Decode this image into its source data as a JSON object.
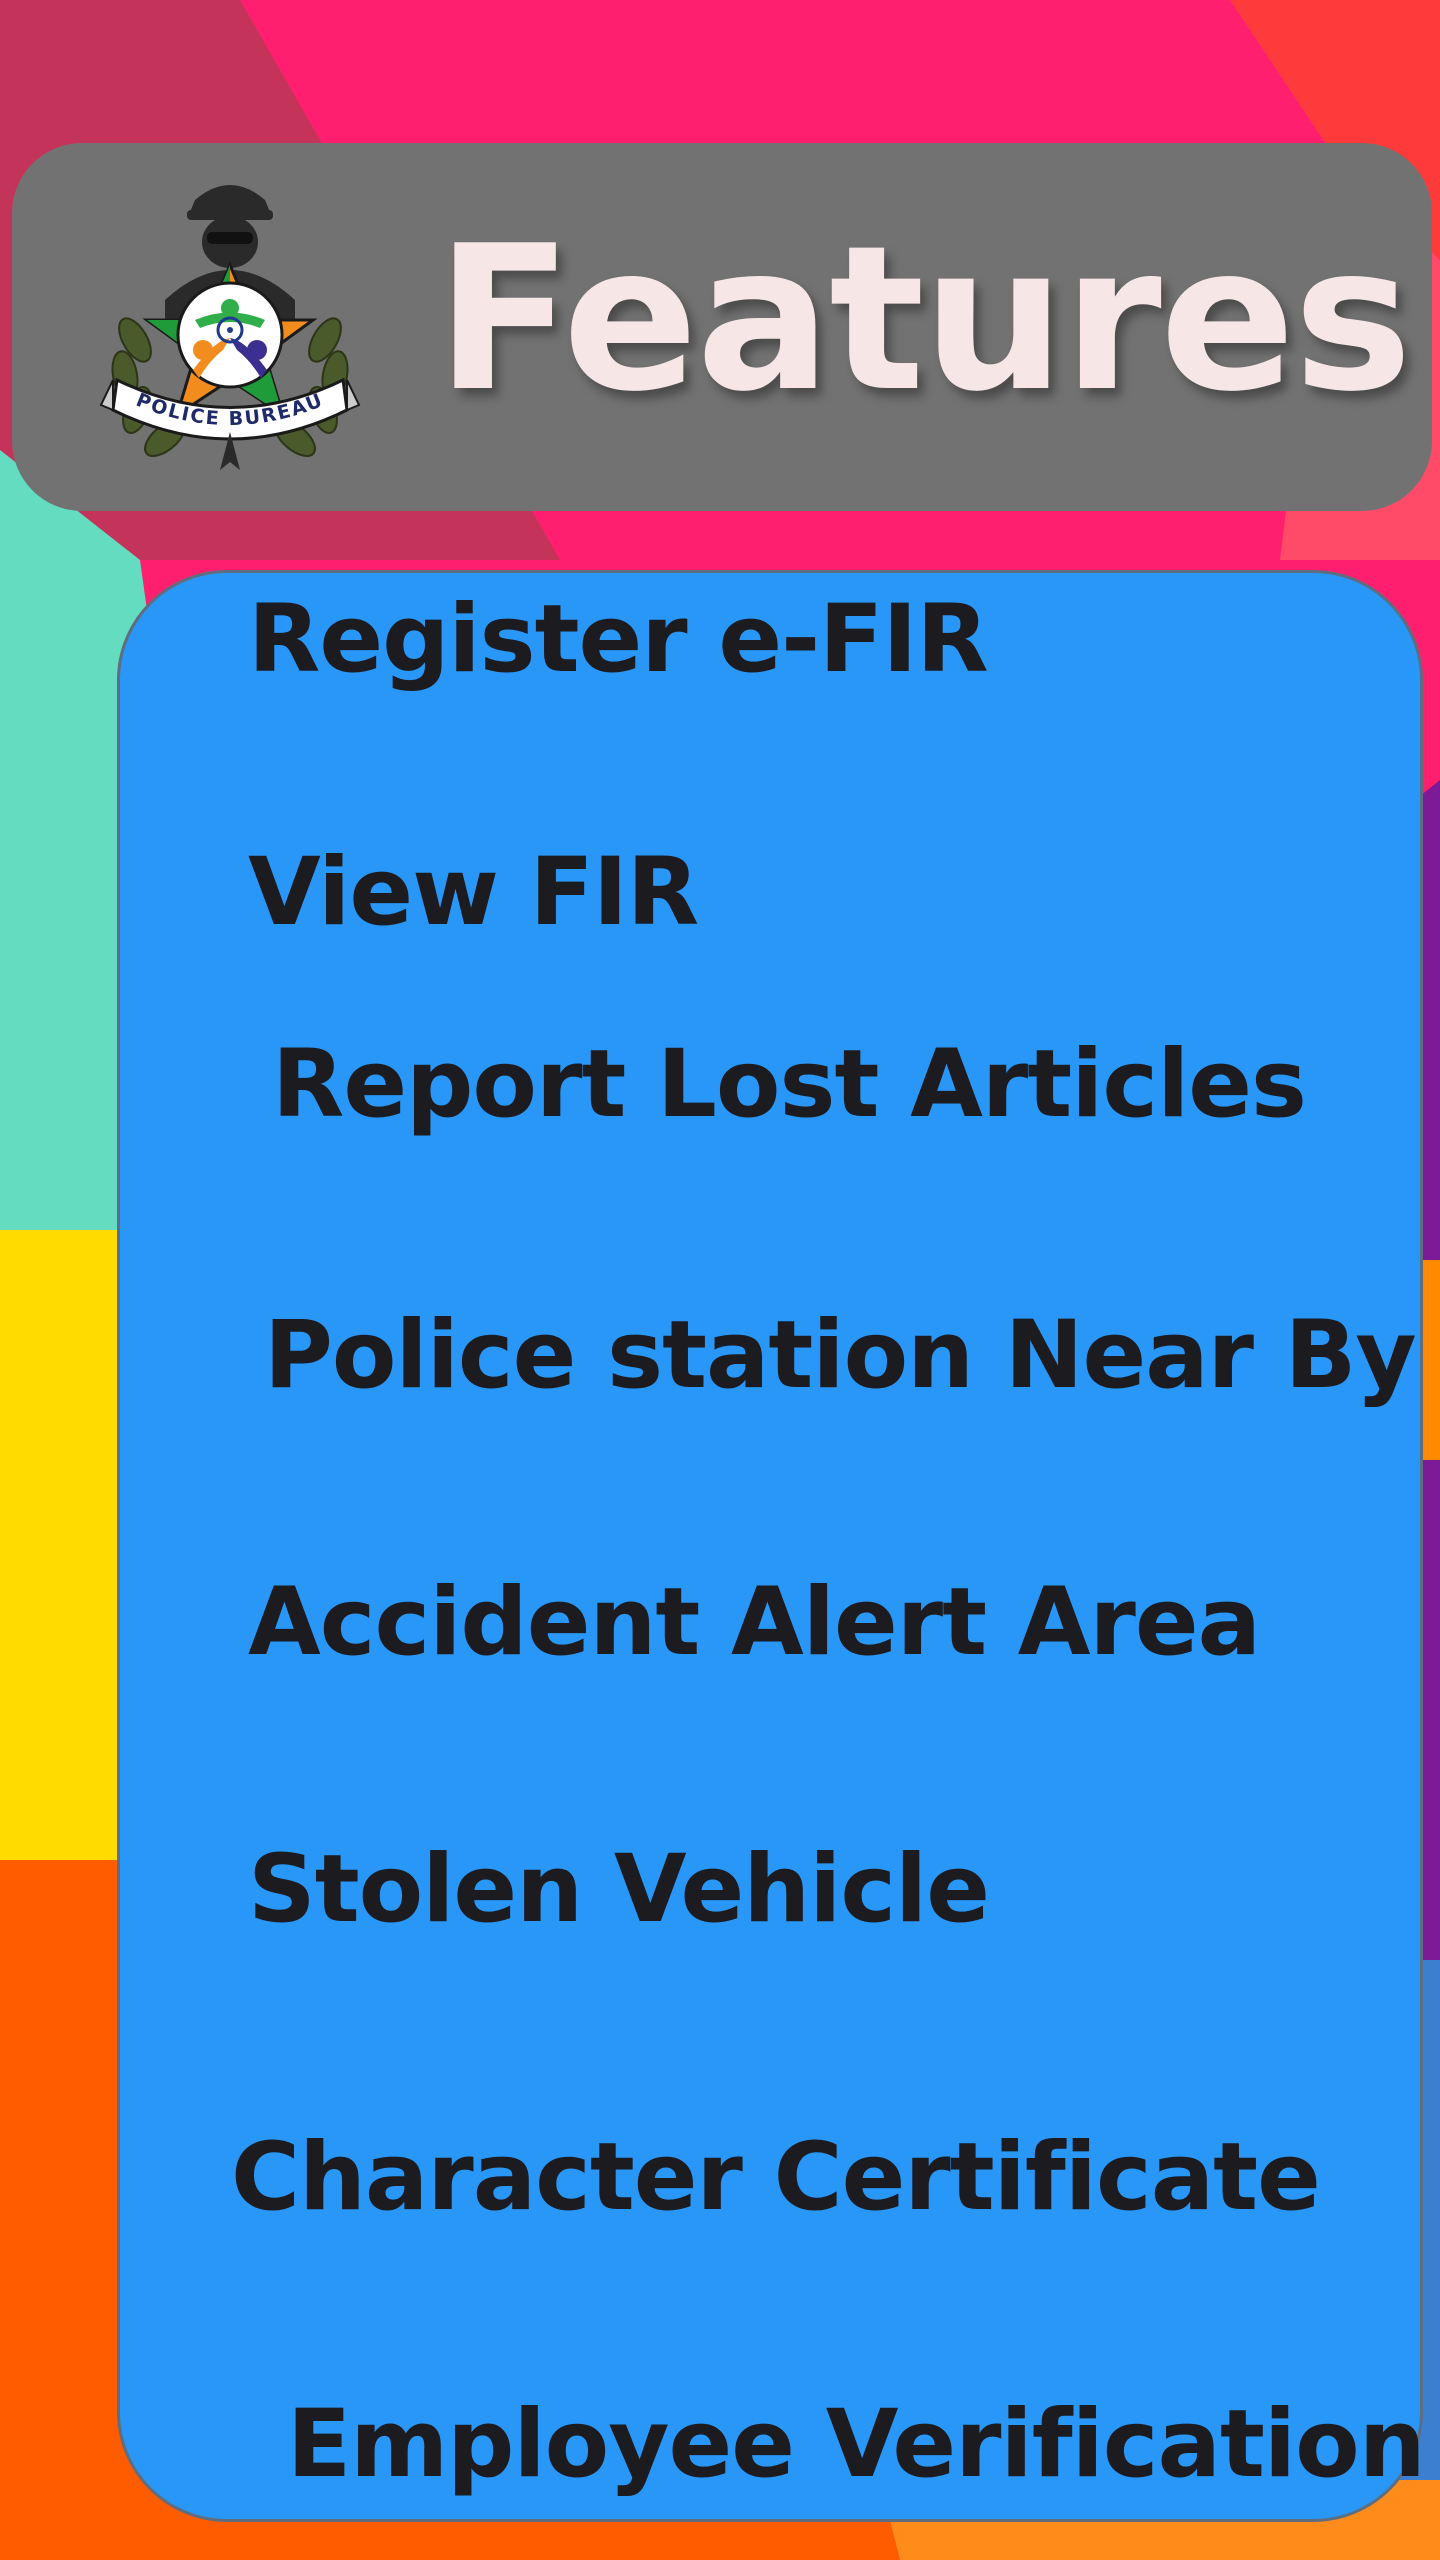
{
  "header": {
    "title": "Features",
    "logo": {
      "icon": "police-bureau-badge-icon",
      "ribbon_text": "POLICE BUREAU"
    }
  },
  "features": [
    {
      "label": "Register e-FIR"
    },
    {
      "label": "View FIR"
    },
    {
      "label": "Report Lost Articles"
    },
    {
      "label": "Police station Near By"
    },
    {
      "label": "Accident Alert Area"
    },
    {
      "label": "Stolen Vehicle"
    },
    {
      "label": "Character Certificate"
    },
    {
      "label": "Employee Verification"
    }
  ],
  "colors": {
    "header_bg": "#727272",
    "header_text": "#f6e6e6",
    "card_bg": "#2997f7",
    "item_text": "#1c1b1f",
    "bg_pink": "#ff1f6e",
    "bg_red": "#ff3d3d",
    "bg_teal": "#63dcc0",
    "bg_yellow": "#ffdb00",
    "bg_orange": "#ff5c00",
    "bg_purple": "#7d1a96"
  }
}
